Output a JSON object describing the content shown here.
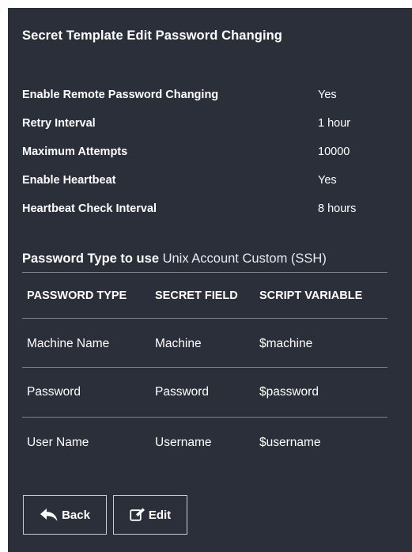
{
  "page": {
    "title": "Secret Template Edit Password Changing"
  },
  "settings": [
    {
      "label": "Enable Remote Password Changing",
      "value": "Yes"
    },
    {
      "label": "Retry Interval",
      "value": "1 hour"
    },
    {
      "label": "Maximum Attempts",
      "value": "10000"
    },
    {
      "label": "Enable Heartbeat",
      "value": "Yes"
    },
    {
      "label": "Heartbeat Check Interval",
      "value": "8 hours"
    }
  ],
  "password_type": {
    "label": "Password Type to use",
    "value": "Unix Account Custom (SSH)"
  },
  "table": {
    "headers": [
      "PASSWORD TYPE",
      "SECRET FIELD",
      "SCRIPT VARIABLE"
    ],
    "rows": [
      [
        "Machine Name",
        "Machine",
        "$machine"
      ],
      [
        "Password",
        "Password",
        "$password"
      ],
      [
        "User Name",
        "Username",
        "$username"
      ]
    ]
  },
  "buttons": {
    "back": {
      "label": "Back",
      "icon": "reply-arrow-icon"
    },
    "edit": {
      "label": "Edit",
      "icon": "pencil-square-icon"
    }
  },
  "colors": {
    "panel_bg": "#2b2f3a",
    "text": "#ffffff",
    "divider": "#7b808c",
    "button_border": "#c8cbd2"
  }
}
